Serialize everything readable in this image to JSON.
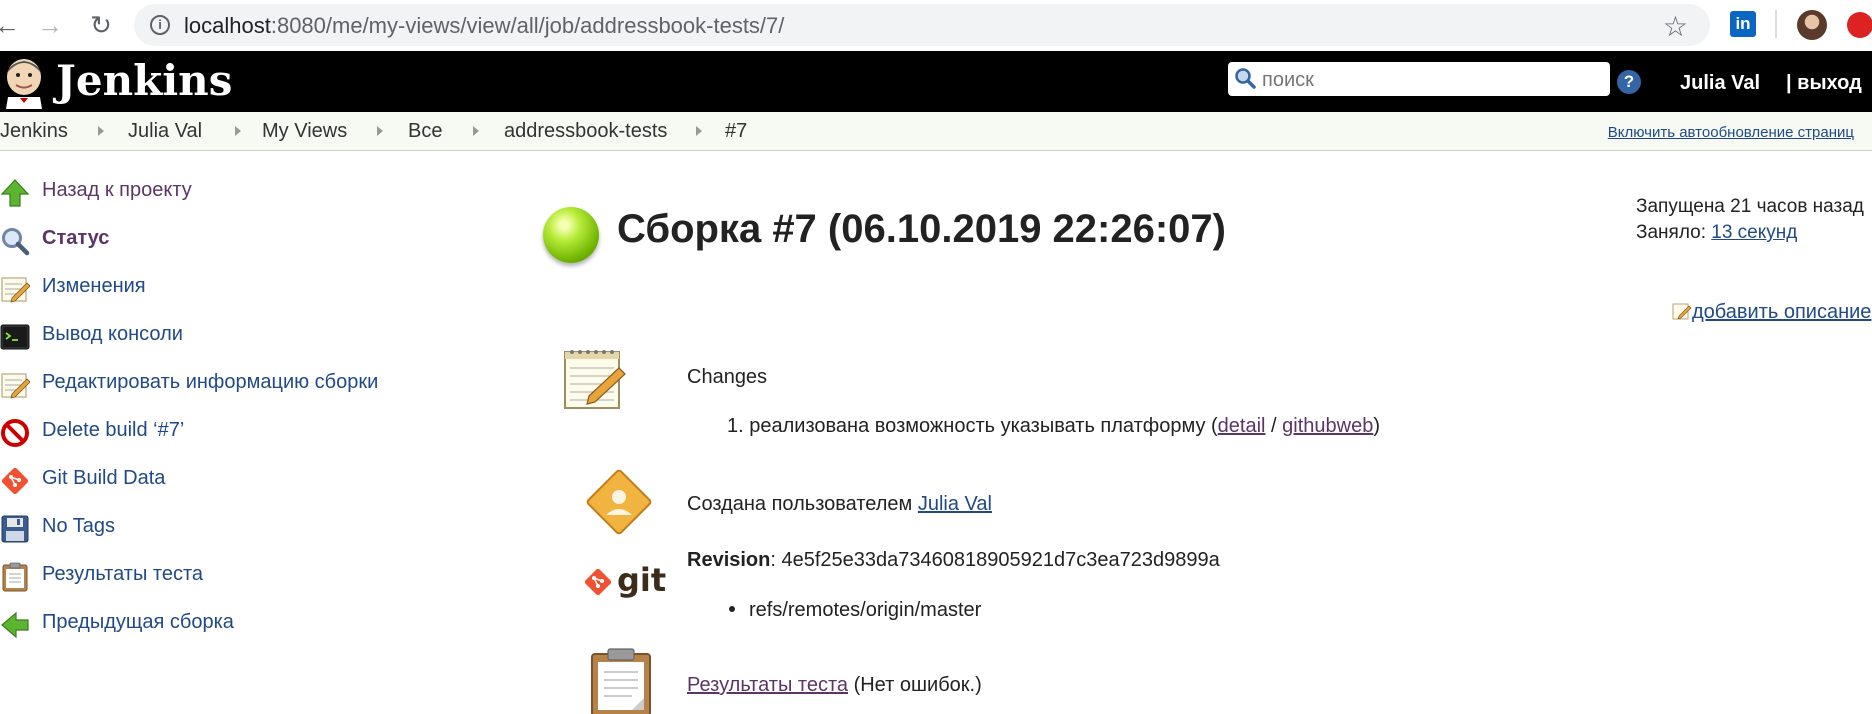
{
  "browser": {
    "url_host": "localhost",
    "url_rest": ":8080/me/my-views/view/all/job/addressbook-tests/7/"
  },
  "header": {
    "logo_text": "Jenkins",
    "search_placeholder": "поиск",
    "help_label": "?",
    "user_name": "Julia Val",
    "logout_label": "| выход"
  },
  "breadcrumbs": [
    "Jenkins",
    "Julia Val",
    "My Views",
    "Все",
    "addressbook-tests",
    "#7"
  ],
  "autorefresh_label": "Включить автообновление страниц",
  "sidebar": {
    "items": [
      {
        "label": "Назад к проекту",
        "icon": "arrow-up-icon"
      },
      {
        "label": "Статус",
        "icon": "magnifier-icon"
      },
      {
        "label": "Изменения",
        "icon": "notepad-icon"
      },
      {
        "label": "Вывод консоли",
        "icon": "terminal-icon"
      },
      {
        "label": "Редактировать информацию сборки",
        "icon": "notepad-icon"
      },
      {
        "label": "Delete build ‘#7’",
        "icon": "no-entry-icon"
      },
      {
        "label": "Git Build Data",
        "icon": "git-icon"
      },
      {
        "label": "No Tags",
        "icon": "floppy-icon"
      },
      {
        "label": "Результаты теста",
        "icon": "clipboard-icon"
      },
      {
        "label": "Предыдущая сборка",
        "icon": "arrow-left-icon"
      }
    ]
  },
  "build": {
    "title": "Сборка #7 (06.10.2019 22:26:07)",
    "status_color": "#7cc400",
    "started": "Запущена 21 часов назад",
    "took_label": "Заняло:",
    "took_value": "13 секунд",
    "add_description": "добавить описание"
  },
  "changes": {
    "heading": "Changes",
    "item_number": "1.",
    "item_text": "реализована возможность указывать платформу",
    "open_paren": " (",
    "detail_link": "detail",
    "slash": " / ",
    "githubweb_link": "githubweb",
    "close_paren": ")"
  },
  "cause": {
    "text": "Создана пользователем",
    "user_link": "Julia Val"
  },
  "git": {
    "logo_text": "git",
    "revision_label": "Revision",
    "revision_colon": ": ",
    "revision_value": "4e5f25e33da73460818905921d7c3ea723d9899a",
    "branch": "refs/remotes/origin/master"
  },
  "tests": {
    "link": "Результаты теста",
    "note": " (Нет ошибок.)"
  }
}
